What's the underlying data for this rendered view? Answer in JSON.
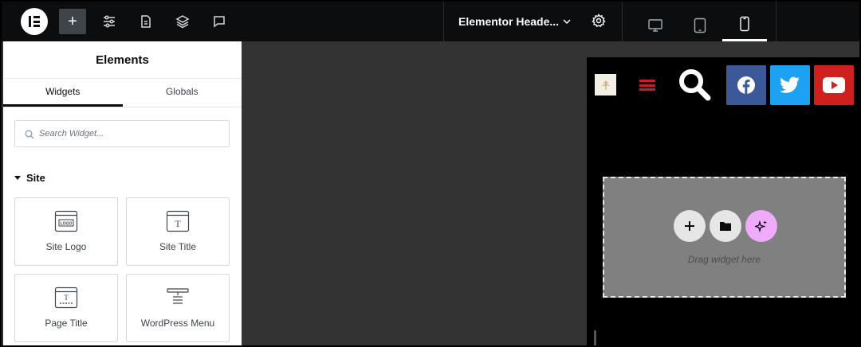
{
  "topbar": {
    "add_button_label": "+",
    "document": {
      "title": "Elementor Heade..."
    },
    "devices": [
      "desktop",
      "tablet",
      "mobile"
    ],
    "active_device": "mobile"
  },
  "panel": {
    "title": "Elements",
    "tabs": [
      {
        "label": "Widgets",
        "active": true
      },
      {
        "label": "Globals",
        "active": false
      }
    ],
    "search": {
      "placeholder": "Search Widget..."
    },
    "category": "Site",
    "widgets": [
      {
        "label": "Site Logo",
        "icon": "site-logo-icon"
      },
      {
        "label": "Site Title",
        "icon": "site-title-icon"
      },
      {
        "label": "Page Title",
        "icon": "page-title-icon"
      },
      {
        "label": "WordPress Menu",
        "icon": "wordpress-menu-icon"
      }
    ]
  },
  "canvas": {
    "social_icons": [
      {
        "name": "facebook",
        "color": "#3b5998"
      },
      {
        "name": "twitter",
        "color": "#1da1f2"
      },
      {
        "name": "youtube",
        "color": "#cd201f"
      }
    ],
    "dropzone": {
      "text": "Drag widget here",
      "ai_color": "#f0abfc"
    }
  },
  "colors": {
    "accent_menu": "#c42121"
  }
}
